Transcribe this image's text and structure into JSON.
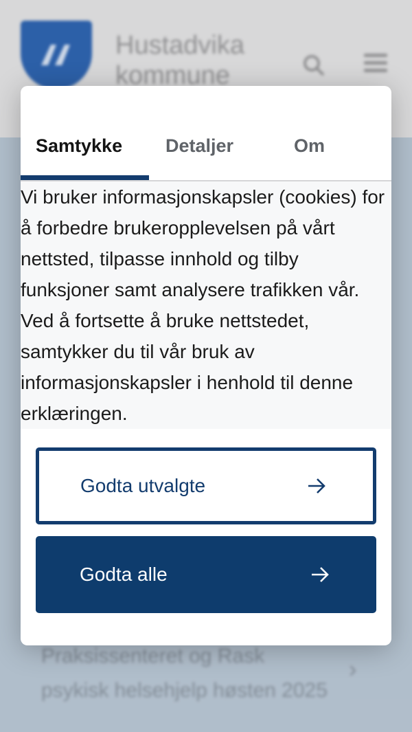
{
  "background": {
    "site_title": "Hustadvika kommune",
    "news_text": "Praksissenteret og Rask psykisk helsehjelp høsten 2025"
  },
  "dialog": {
    "tabs": [
      {
        "label": "Samtykke",
        "active": true
      },
      {
        "label": "Detaljer",
        "active": false
      },
      {
        "label": "Om",
        "active": false
      }
    ],
    "body": "Vi bruker informasjonskapsler (cookies) for å forbedre brukeropplevelsen på vårt nettsted, tilpasse innhold og tilby funksjoner samt analysere trafikken vår. Ved å fortsette å bruke nettstedet, samtykker du til vår bruk av informasjonskapsler i henhold til denne erklæringen.",
    "accept_selected_label": "Godta utvalgte",
    "accept_all_label": "Godta alle"
  },
  "colors": {
    "primary": "#0e3c6d",
    "background_blue": "#bccad8",
    "logo_blue": "#2f66b3"
  },
  "icons": {
    "arrow": "arrow-right-icon",
    "search": "search-icon",
    "menu": "hamburger-menu-icon",
    "chevron": "chevron-right-icon"
  }
}
